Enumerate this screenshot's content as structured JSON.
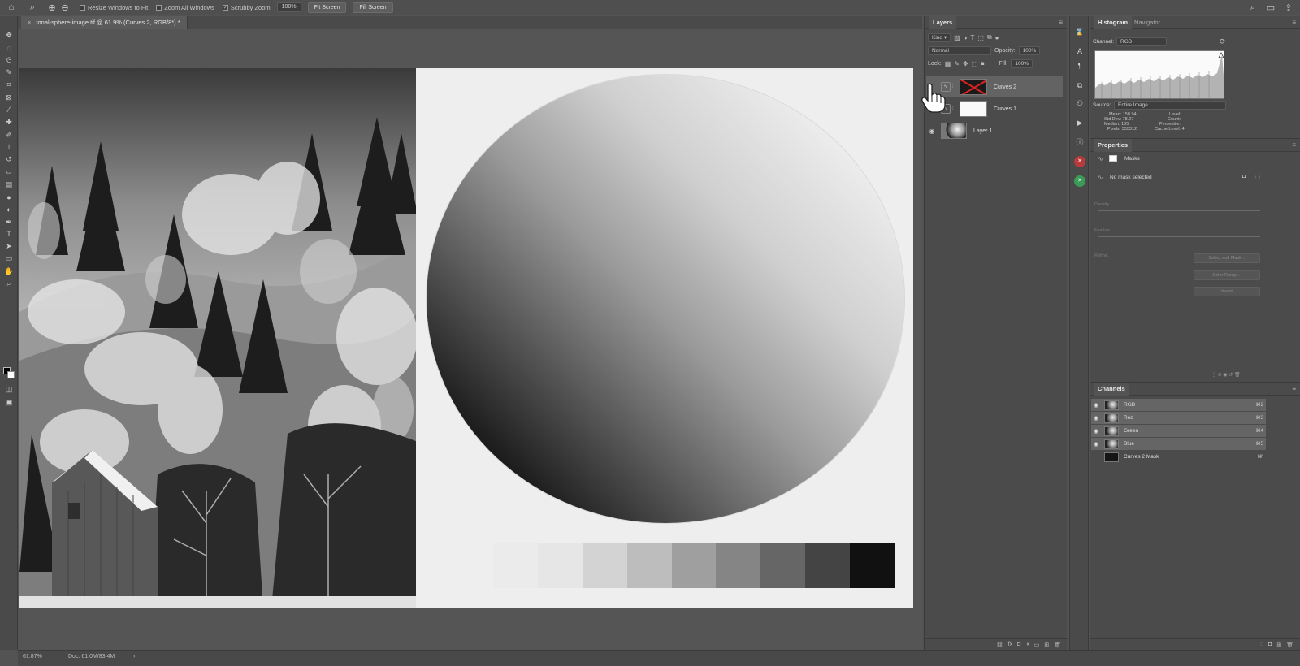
{
  "options_bar": {
    "resize_windows": "Resize Windows to Fit",
    "zoom_all": "Zoom All Windows",
    "scrubby_zoom": "Scrubby Zoom",
    "zoom_value": "100%",
    "fit_screen": "Fit Screen",
    "fill_screen": "Fill Screen"
  },
  "document": {
    "tab_title": "tonal-sphere-image.tif @ 61.9% (Curves 2, RGB/8*) *",
    "close_glyph": "×"
  },
  "status": {
    "zoom": "61.87%",
    "doc": "Doc: 61.0M/83.4M"
  },
  "tonal_steps": [
    "#ebebeb",
    "#e6e6e6",
    "#d3d3d3",
    "#bdbdbd",
    "#9f9f9f",
    "#858585",
    "#666666",
    "#444444",
    "#111111"
  ],
  "layers": {
    "title": "Layers",
    "kind": "Kind",
    "blend_mode": "Normal",
    "opacity_label": "Opacity:",
    "opacity_value": "100%",
    "lock_label": "Lock:",
    "fill_label": "Fill:",
    "fill_value": "100%",
    "items": [
      {
        "name": "Curves 2"
      },
      {
        "name": "Curves 1"
      },
      {
        "name": "Layer 1"
      }
    ]
  },
  "histogram": {
    "tab": "Histogram",
    "tab2": "Navigator",
    "channel_label": "Channel:",
    "channel_value": "RGB",
    "source_label": "Source:",
    "source_value": "Entire Image",
    "stats_left": [
      "Mean: 158.94",
      "Std Dev: 78.27",
      "Median: 185",
      "Pixels: 333312"
    ],
    "stats_right": [
      "Level:",
      "Count:",
      "Percentile:",
      "Cache Level: 4"
    ]
  },
  "properties": {
    "title": "Properties",
    "masks_label": "Masks",
    "no_mask": "No mask selected",
    "density": "Density",
    "feather": "Feather",
    "refine": "Refine:",
    "select_mask": "Select and Mask...",
    "color_range": "Color Range...",
    "invert": "Invert"
  },
  "channels": {
    "title": "Channels",
    "items": [
      {
        "name": "RGB",
        "key": "⌘2"
      },
      {
        "name": "Red",
        "key": "⌘3"
      },
      {
        "name": "Green",
        "key": "⌘4"
      },
      {
        "name": "Blue",
        "key": "⌘5"
      },
      {
        "name": "Curves 2 Mask",
        "key": "⌘\\"
      }
    ]
  }
}
